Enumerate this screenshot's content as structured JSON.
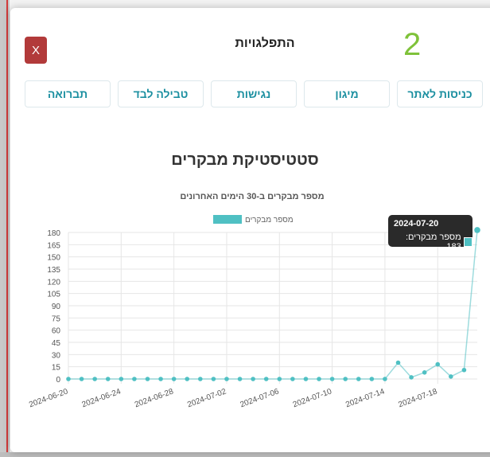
{
  "modal": {
    "title": "התפלגויות",
    "close_label": "X",
    "count": "2"
  },
  "tabs": [
    {
      "label": "כניסות לאתר"
    },
    {
      "label": "מיגון"
    },
    {
      "label": "נגישות"
    },
    {
      "label": "טבילה לבד"
    },
    {
      "label": "תברואה"
    }
  ],
  "section": {
    "title": "סטטיסטיקת מבקרים"
  },
  "tooltip": {
    "date": "2024-07-20",
    "text": "מספר מבקרים: 183"
  },
  "colors": {
    "line": "#4fc0c3",
    "tab_text": "#1b8fa0",
    "close_bg": "#b23a3a",
    "count": "#7fc23a"
  },
  "chart_data": {
    "type": "line",
    "title": "מספר מבקרים ב-30 הימים האחרונים",
    "legend": "מספר מבקרים",
    "legend_position": "top",
    "x": [
      "2024-06-20",
      "2024-06-21",
      "2024-06-22",
      "2024-06-23",
      "2024-06-24",
      "2024-06-25",
      "2024-06-26",
      "2024-06-27",
      "2024-06-28",
      "2024-06-29",
      "2024-06-30",
      "2024-07-01",
      "2024-07-02",
      "2024-07-03",
      "2024-07-04",
      "2024-07-05",
      "2024-07-06",
      "2024-07-07",
      "2024-07-08",
      "2024-07-09",
      "2024-07-10",
      "2024-07-11",
      "2024-07-12",
      "2024-07-13",
      "2024-07-14",
      "2024-07-15",
      "2024-07-16",
      "2024-07-17",
      "2024-07-18",
      "2024-07-19",
      "2024-07-20"
    ],
    "x_tick_labels": [
      "2024-06-20",
      "2024-06-24",
      "2024-06-28",
      "2024-07-02",
      "2024-07-06",
      "2024-07-10",
      "2024-07-14",
      "2024-07-18"
    ],
    "values": [
      0,
      0,
      0,
      0,
      0,
      0,
      0,
      0,
      0,
      0,
      0,
      0,
      0,
      0,
      0,
      0,
      0,
      0,
      0,
      0,
      0,
      0,
      0,
      0,
      0,
      20,
      2,
      8,
      18,
      3,
      11,
      183
    ],
    "ylim": [
      0,
      180
    ],
    "y_ticks": [
      0,
      15,
      30,
      45,
      60,
      75,
      90,
      105,
      120,
      135,
      150,
      165,
      180
    ],
    "grid": true
  }
}
